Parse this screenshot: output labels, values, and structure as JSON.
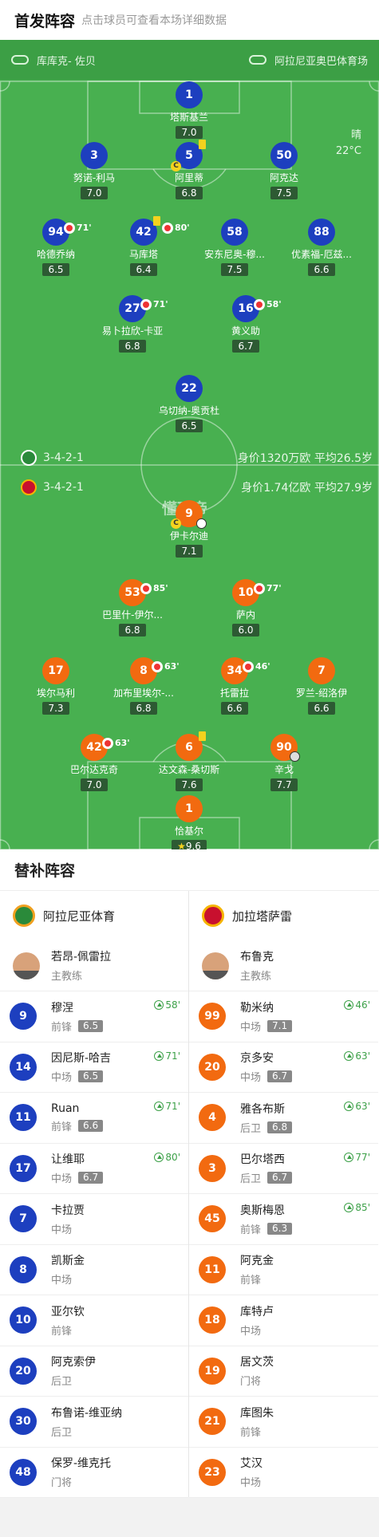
{
  "header": {
    "title": "首发阵容",
    "subtitle": "点击球员可查看本场详细数据"
  },
  "venue": {
    "referee": "库库克- 佐贝",
    "stadium": "阿拉尼亚奥巴体育场"
  },
  "weather": {
    "condition": "晴",
    "temperature": "22°C"
  },
  "watermark": "懂球帝",
  "formations": {
    "home": {
      "formation": "3-4-2-1",
      "value": "身价1320万欧 平均26.5岁"
    },
    "away": {
      "formation": "3-4-2-1",
      "value": "身价1.74亿欧 平均27.9岁"
    }
  },
  "home_lineup": [
    {
      "number": "1",
      "name": "塔斯基兰",
      "rating": "7.0"
    },
    {
      "number": "3",
      "name": "努诺-利马",
      "rating": "7.0"
    },
    {
      "number": "5",
      "name": "阿里蒂",
      "rating": "6.8",
      "captain": "C"
    },
    {
      "number": "50",
      "name": "阿克达",
      "rating": "7.5"
    },
    {
      "number": "94",
      "name": "哈德乔纳",
      "rating": "6.5",
      "sub_out": "71'"
    },
    {
      "number": "42",
      "name": "马库塔",
      "rating": "6.4",
      "sub_out": "80'"
    },
    {
      "number": "58",
      "name": "安东尼奥-穆...",
      "rating": "7.5"
    },
    {
      "number": "88",
      "name": "优素福-厄兹...",
      "rating": "6.6"
    },
    {
      "number": "27",
      "name": "易卜拉欣-卡亚",
      "rating": "6.8",
      "sub_out": "71'"
    },
    {
      "number": "16",
      "name": "黄义助",
      "rating": "6.7",
      "sub_out": "58'"
    },
    {
      "number": "22",
      "name": "乌切纳-奥贡杜",
      "rating": "6.5"
    }
  ],
  "away_lineup": [
    {
      "number": "9",
      "name": "伊卡尔迪",
      "rating": "7.1",
      "captain": "C"
    },
    {
      "number": "53",
      "name": "巴里什-伊尔...",
      "rating": "6.8",
      "sub_out": "85'"
    },
    {
      "number": "10",
      "name": "萨内",
      "rating": "6.0",
      "sub_out": "77'"
    },
    {
      "number": "17",
      "name": "埃尔马利",
      "rating": "7.3"
    },
    {
      "number": "8",
      "name": "加布里埃尔-...",
      "rating": "6.8",
      "sub_out": "63'"
    },
    {
      "number": "34",
      "name": "托雷拉",
      "rating": "6.6",
      "sub_out": "46'"
    },
    {
      "number": "7",
      "name": "罗兰-绍洛伊",
      "rating": "6.6"
    },
    {
      "number": "42",
      "name": "巴尔达克奇",
      "rating": "7.0",
      "sub_out": "63'"
    },
    {
      "number": "6",
      "name": "达文森-桑切斯",
      "rating": "7.6"
    },
    {
      "number": "90",
      "name": "辛戈",
      "rating": "7.7"
    },
    {
      "number": "1",
      "name": "恰基尔",
      "rating": "9.6"
    }
  ],
  "subs_title": "替补阵容",
  "home_team": {
    "name": "阿拉尼亚体育",
    "coach": "若昂-佩雷拉",
    "coach_role": "主教练"
  },
  "away_team": {
    "name": "加拉塔萨雷",
    "coach": "布鲁克",
    "coach_role": "主教练"
  },
  "home_subs": [
    {
      "number": "9",
      "name": "穆涅",
      "position": "前锋",
      "rating": "6.5",
      "in": "58'"
    },
    {
      "number": "14",
      "name": "因尼斯-哈吉",
      "position": "中场",
      "rating": "6.5",
      "in": "71'"
    },
    {
      "number": "11",
      "name": "Ruan",
      "position": "前锋",
      "rating": "6.6",
      "in": "71'"
    },
    {
      "number": "17",
      "name": "让维耶",
      "position": "中场",
      "rating": "6.7",
      "in": "80'"
    },
    {
      "number": "7",
      "name": "卡拉贾",
      "position": "中场"
    },
    {
      "number": "8",
      "name": "凯斯金",
      "position": "中场"
    },
    {
      "number": "10",
      "name": "亚尔钦",
      "position": "前锋"
    },
    {
      "number": "20",
      "name": "阿克索伊",
      "position": "后卫"
    },
    {
      "number": "30",
      "name": "布鲁诺-维亚纳",
      "position": "后卫"
    },
    {
      "number": "48",
      "name": "保罗-维克托",
      "position": "门将"
    }
  ],
  "away_subs": [
    {
      "number": "99",
      "name": "勒米纳",
      "position": "中场",
      "rating": "7.1",
      "in": "46'"
    },
    {
      "number": "20",
      "name": "京多安",
      "position": "中场",
      "rating": "6.7",
      "in": "63'"
    },
    {
      "number": "4",
      "name": "雅各布斯",
      "position": "后卫",
      "rating": "6.8",
      "in": "63'"
    },
    {
      "number": "3",
      "name": "巴尔塔西",
      "position": "后卫",
      "rating": "6.7",
      "in": "77'"
    },
    {
      "number": "45",
      "name": "奥斯梅恩",
      "position": "前锋",
      "rating": "6.3",
      "in": "85'"
    },
    {
      "number": "11",
      "name": "阿克金",
      "position": "前锋"
    },
    {
      "number": "18",
      "name": "库特卢",
      "position": "中场"
    },
    {
      "number": "19",
      "name": "居文茨",
      "position": "门将"
    },
    {
      "number": "21",
      "name": "库图朱",
      "position": "前锋"
    },
    {
      "number": "23",
      "name": "艾汉",
      "position": "中场"
    }
  ],
  "colors": {
    "home": "#1d3fbf",
    "away": "#f26a10",
    "pitch": "#48b050"
  }
}
